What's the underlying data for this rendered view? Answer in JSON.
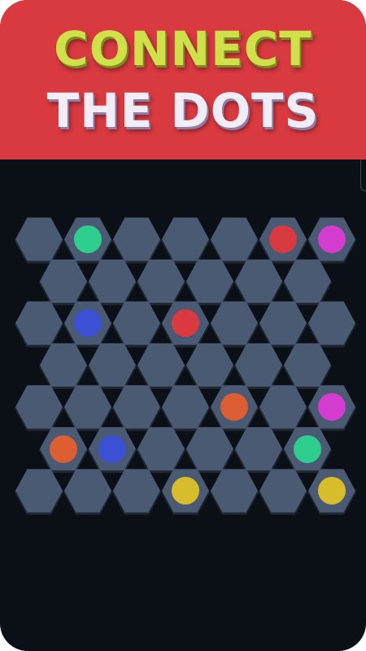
{
  "banner": {
    "line1": "CONNECT",
    "line2": "THE DOTS",
    "background": "#d93a40"
  },
  "colors": {
    "green": "#2ecf8e",
    "red": "#d93a40",
    "magenta": "#d43cd0",
    "blue": "#3c50d6",
    "orange": "#de5e33",
    "yellow": "#d7bd2c",
    "cell": "#4a5a72",
    "background": "#0b1017"
  },
  "board": {
    "rows": [
      [
        "",
        "green",
        "",
        "",
        "",
        "red",
        "magenta"
      ],
      [
        "",
        "",
        "",
        "",
        "",
        ""
      ],
      [
        "",
        "blue",
        "",
        "red",
        "",
        "",
        ""
      ],
      [
        "",
        "",
        "",
        "",
        "",
        ""
      ],
      [
        "",
        "",
        "",
        "",
        "orange",
        "",
        "magenta"
      ],
      [
        "orange",
        "blue",
        "",
        "",
        "",
        "green"
      ],
      [
        "",
        "",
        "",
        "yellow",
        "",
        "",
        "yellow"
      ]
    ]
  }
}
